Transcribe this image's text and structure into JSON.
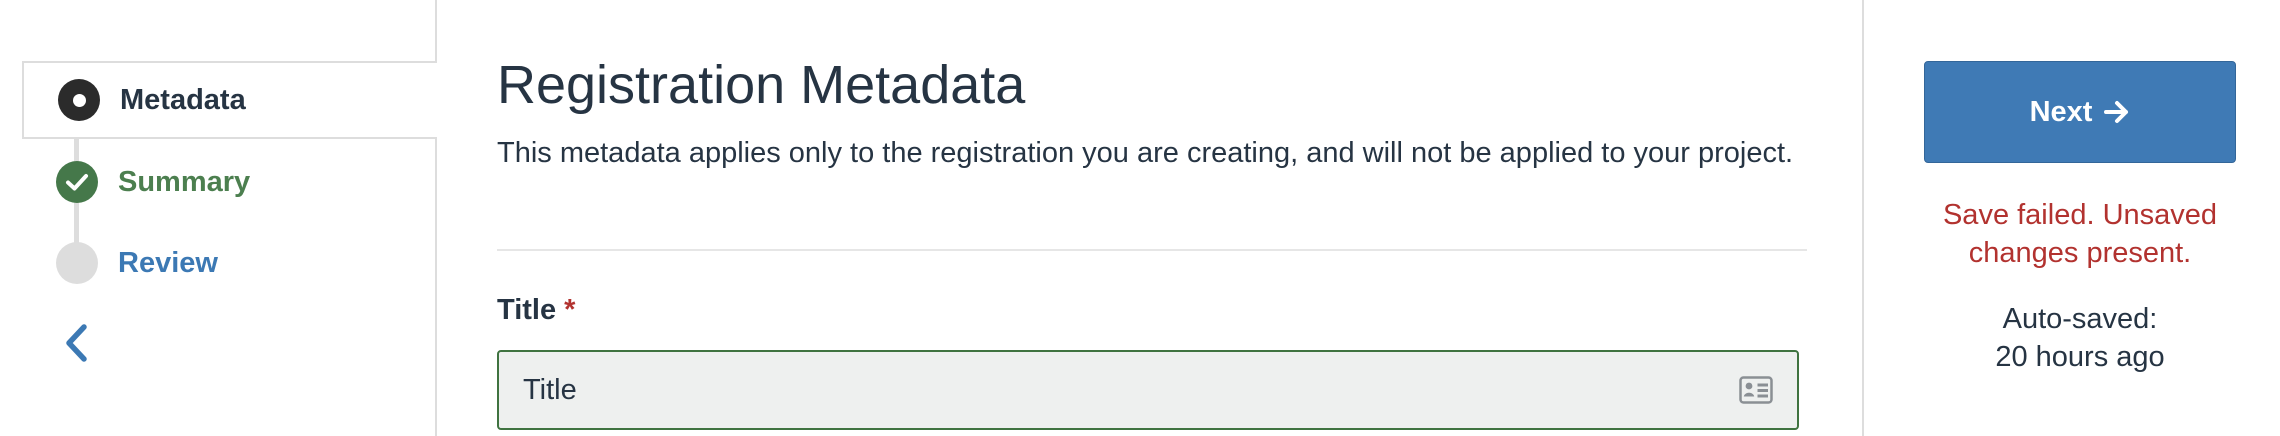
{
  "sidebar": {
    "steps": [
      {
        "label": "Metadata",
        "state": "current"
      },
      {
        "label": "Summary",
        "state": "complete"
      },
      {
        "label": "Review",
        "state": "pending"
      }
    ],
    "collapse_icon": "chevron-left-icon"
  },
  "main": {
    "title": "Registration Metadata",
    "description": "This metadata applies only to the registration you are creating, and will not be applied to your project.",
    "field": {
      "label": "Title",
      "required_marker": "*",
      "placeholder": "Title",
      "value": "",
      "icon": "id-card-icon"
    }
  },
  "right_panel": {
    "next_label": "Next",
    "next_icon": "arrow-right-icon",
    "save_status": "Save failed. Unsaved changes present.",
    "autosave_label": "Auto-saved:",
    "autosave_time": "20 hours ago"
  },
  "colors": {
    "primary": "#3f7ab5",
    "success": "#4c7f4f",
    "danger": "#b2322f",
    "text": "#263443",
    "border": "#dddddd"
  }
}
